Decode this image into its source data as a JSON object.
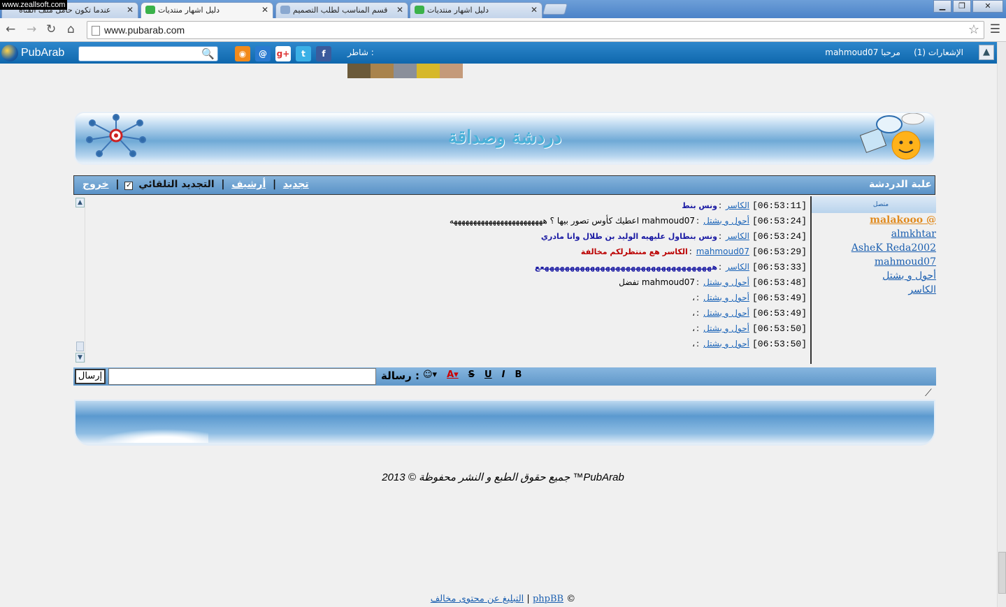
{
  "watermark": "www.zeallsoft.com",
  "browser": {
    "tabs": [
      {
        "label": "عندما تكون حامل ملف الفتاة"
      },
      {
        "label": "دليل اشهار منتديات"
      },
      {
        "label": "قسم المناسب لطلب التصميم"
      },
      {
        "label": "دليل اشهار منتديات"
      }
    ],
    "url": "www.pubarab.com"
  },
  "topbar": {
    "logo": "PubArab",
    "share_label": "شاطر :",
    "greeting": "مرحبا mahmoud07",
    "notifications": "الإشعارات (1)",
    "social": [
      "rss-icon",
      "email-icon",
      "googleplus-icon",
      "twitter-icon",
      "facebook-icon"
    ]
  },
  "banner": {
    "title": "دردشة وصداقة"
  },
  "chat": {
    "title": "علبة الدردشة",
    "actions": {
      "refresh": "تجديد",
      "archive": "أرشيف",
      "auto_refresh": "التجديد التلقائي",
      "logout": "خروج"
    },
    "messages": [
      {
        "time": "[06:53:11]",
        "user": "الكاسر",
        "text": "ونس بنط",
        "style": "b"
      },
      {
        "time": "[06:53:24]",
        "user": "أحول و بشتل",
        "text": "mahmoud07 اعطيك كأوس تصور بيها ؟ ههههههههههههههههههههههههه",
        "style": ""
      },
      {
        "time": "[06:53:24]",
        "user": "الكاسر",
        "text": "ونس بنطاول عليهيه الوليد بن طلال وانا مادري",
        "style": "b"
      },
      {
        "time": "[06:53:29]",
        "user": "mahmoud07",
        "text": "الكاسر هع منتظرلكم مخالفة",
        "style": "r"
      },
      {
        "time": "[06:53:33]",
        "user": "الكاسر",
        "text": "ههههههههههههههههههههههههههههههههههعع",
        "style": "b"
      },
      {
        "time": "[06:53:48]",
        "user": "أحول و بشتل",
        "text": "mahmoud07 تفضل",
        "style": ""
      },
      {
        "time": "[06:53:49]",
        "user": "أحول و بشتل",
        "text": "،",
        "style": ""
      },
      {
        "time": "[06:53:49]",
        "user": "أحول و بشتل",
        "text": "،",
        "style": ""
      },
      {
        "time": "[06:53:50]",
        "user": "أحول و بشتل",
        "text": "،",
        "style": ""
      },
      {
        "time": "[06:53:50]",
        "user": "أحول و بشتل",
        "text": "،",
        "style": ""
      }
    ],
    "online_header": "متصل",
    "online_users": [
      "malakooo @",
      "almkhtar",
      "AsheK Reda2002",
      "mahmoud07",
      "أحول و بشتل",
      "الكاسر"
    ],
    "send_label": "إرسال",
    "message_label": "رسالة :",
    "tools": [
      "B",
      "U",
      "I",
      "S",
      "A",
      "☺"
    ]
  },
  "footer": {
    "copyright": "جميع حقوق الطبع و النشر محفوظة © 2013 ™PubArab",
    "links": {
      "report": "التبليغ عن محتوى مخالف",
      "phpbb": "phpBB",
      "copy": "©"
    }
  },
  "colors": {
    "accent": "#1067ad",
    "link": "#1b5fb0",
    "highlight_user": "#e08a1e"
  }
}
